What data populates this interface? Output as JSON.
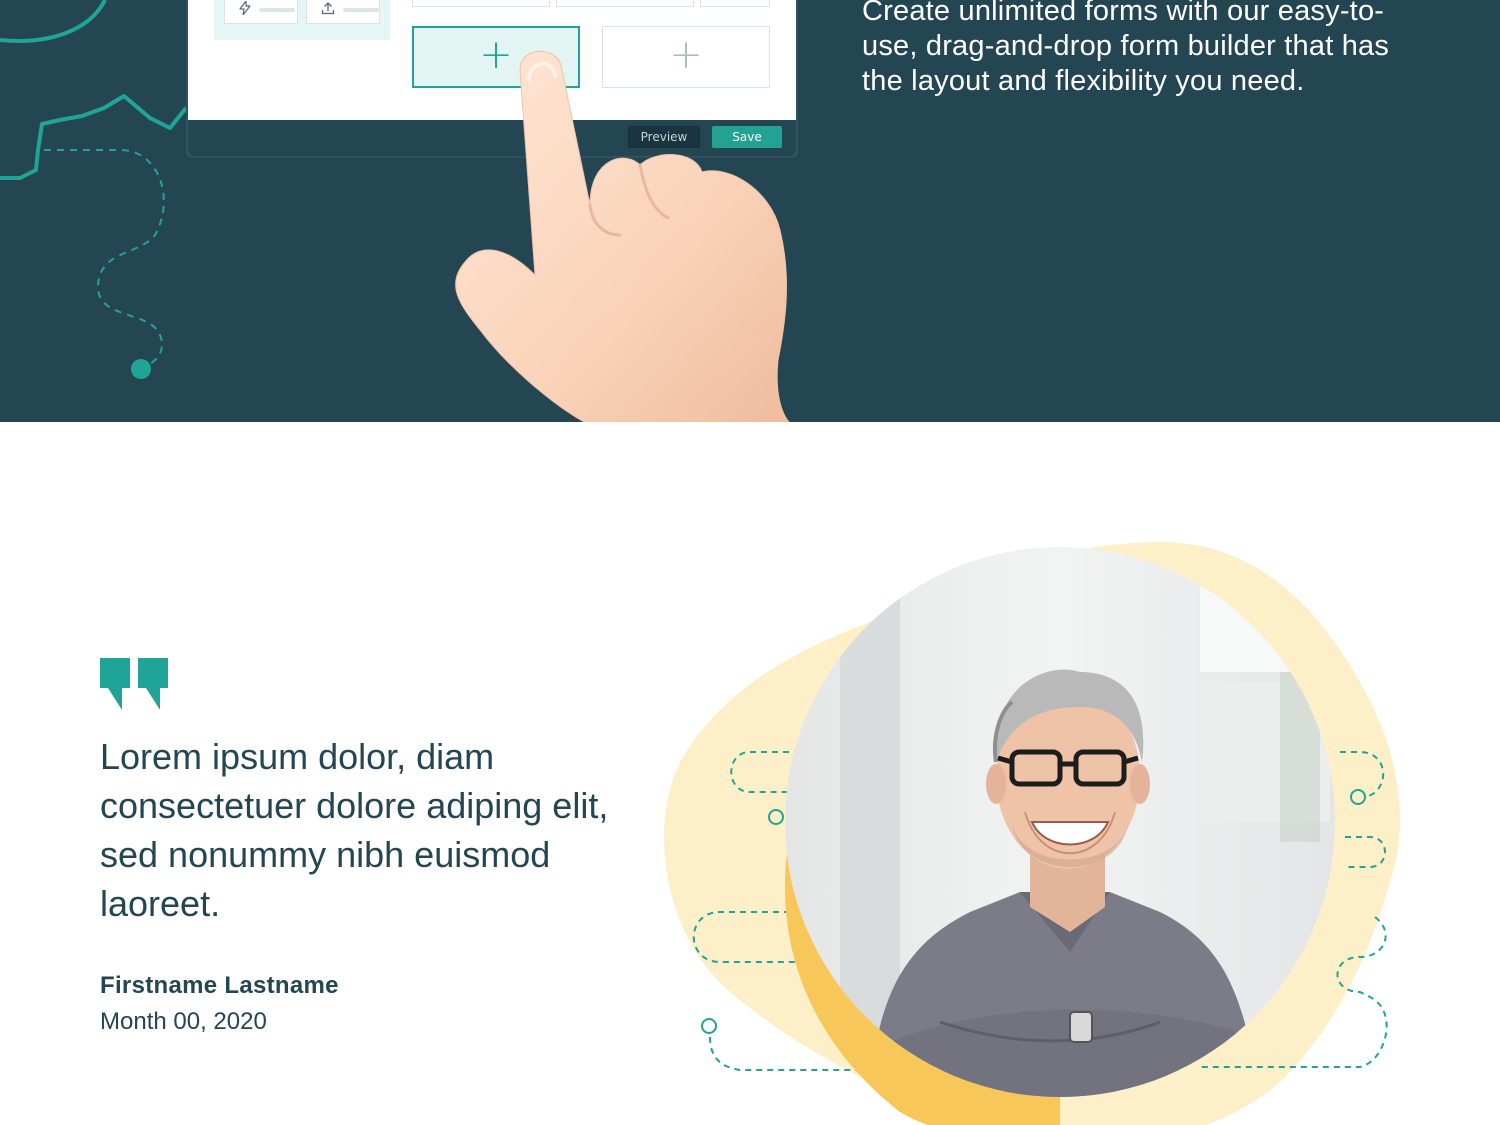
{
  "hero": {
    "description": "Create unlimited forms with our easy-to-use, drag-and-drop form builder that has the layout and flexibility you need.",
    "builder": {
      "preview_label": "Preview",
      "save_label": "Save",
      "add_symbol": "+"
    },
    "icons": [
      "lightning-icon",
      "upload-icon",
      "plus-icon",
      "pointing-hand-illustration"
    ]
  },
  "testimonial": {
    "quote": "Lorem ipsum dolor, diam consectetuer dolore adiping elit, sed nonummy nibh euismod laoreet.",
    "author_name": "Firstname Lastname",
    "author_date": "Month 00, 2020",
    "icons": [
      "quote-icon",
      "portrait-photo"
    ]
  },
  "colors": {
    "hero_bg": "#244653",
    "accent_teal": "#20a497",
    "text_dark": "#244653",
    "blob_light_yellow": "#fdefc8",
    "blob_yellow": "#f8c75a",
    "white": "#ffffff"
  }
}
